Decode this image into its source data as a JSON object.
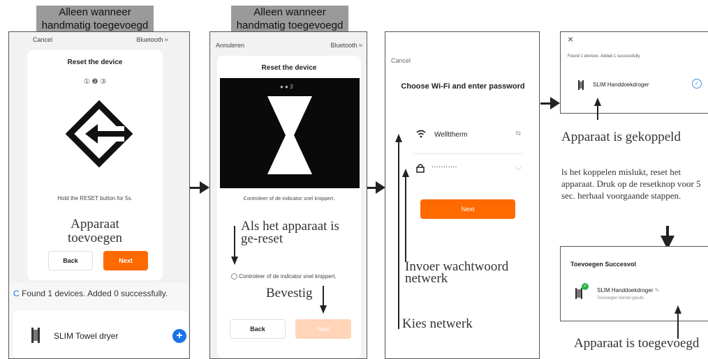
{
  "labels": {
    "handmatig_1": "Alleen wanneer handmatig toegevoegd",
    "handmatig_2": "Alleen wanneer handmatig toegevoegd"
  },
  "screen1": {
    "cancel": "Cancel",
    "bluetooth": "Bluetooth",
    "title": "Reset the device",
    "steps": [
      "①",
      "❷",
      "③"
    ],
    "hint": "Hold the RESET button for 5s.",
    "annotation": "Apparaat toevoegen",
    "back": "Back",
    "next": "Next",
    "found": "Found 1 devices. Added 0 successfully.",
    "device_name": "SLIM Towel dryer"
  },
  "screen2": {
    "cancel": "Annuleren",
    "bluetooth": "Bluetooth",
    "title": "Reset the device",
    "step_badge": "3",
    "hint": "Controleer of de indicator snel knippert.",
    "annotation_reset": "Als het apparaat is ge-reset",
    "checkbox_label": "Controleer of de indicator snel knippert.",
    "annotation_confirm": "Bevestig",
    "back": "Back",
    "next": "Next"
  },
  "screen3": {
    "cancel": "Cancel",
    "title": "Choose Wi-Fi and enter password",
    "network": "Wellttherm",
    "password": "···········",
    "next": "Next",
    "annotation_input": "Invoer wachtwoord netwerk",
    "annotation_network": "Kies netwerk"
  },
  "screen4": {
    "close": "×",
    "found": "Found 1 devices. Added 1 successfully.",
    "device_name": "SLIM Handdoekdroger",
    "annotation_connected": "Apparaat is gekoppeld",
    "annotation_failed": "ls het koppelen mislukt, reset het apparaat. Druk op de resetknop voor 5 sec. herhaal voorgaande stappen."
  },
  "screen5": {
    "title": "Toevoegen Succesvol",
    "device_name": "SLIM Handdoekdroger",
    "device_sub": "Toevoegen toestel gelukt.",
    "annotation_added": "Apparaat is toegevoegd"
  },
  "colors": {
    "accent": "#ff6a00",
    "blue": "#1a73e8"
  }
}
